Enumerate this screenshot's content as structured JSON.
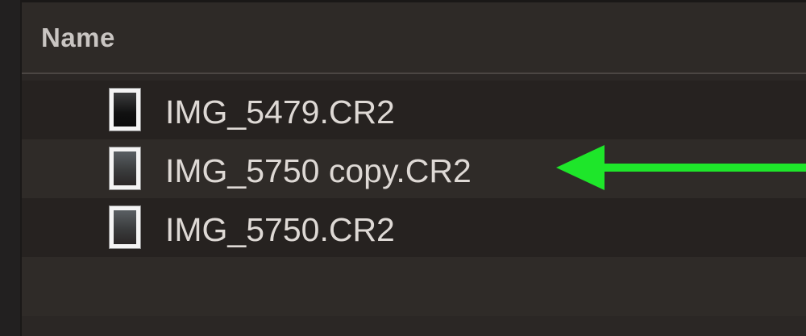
{
  "header": {
    "name_column_label": "Name"
  },
  "files": [
    {
      "name": "IMG_5479.CR2",
      "icon": "image-file-icon"
    },
    {
      "name": "IMG_5750 copy.CR2",
      "icon": "image-file-icon"
    },
    {
      "name": "IMG_5750.CR2",
      "icon": "image-file-icon"
    }
  ],
  "annotation": {
    "arrow_color": "#1ee62a",
    "points_to": "IMG_5750 copy.CR2"
  },
  "colors": {
    "background": "#2b2725",
    "text": "#ded9d5",
    "header_text": "#c9c5c2"
  }
}
